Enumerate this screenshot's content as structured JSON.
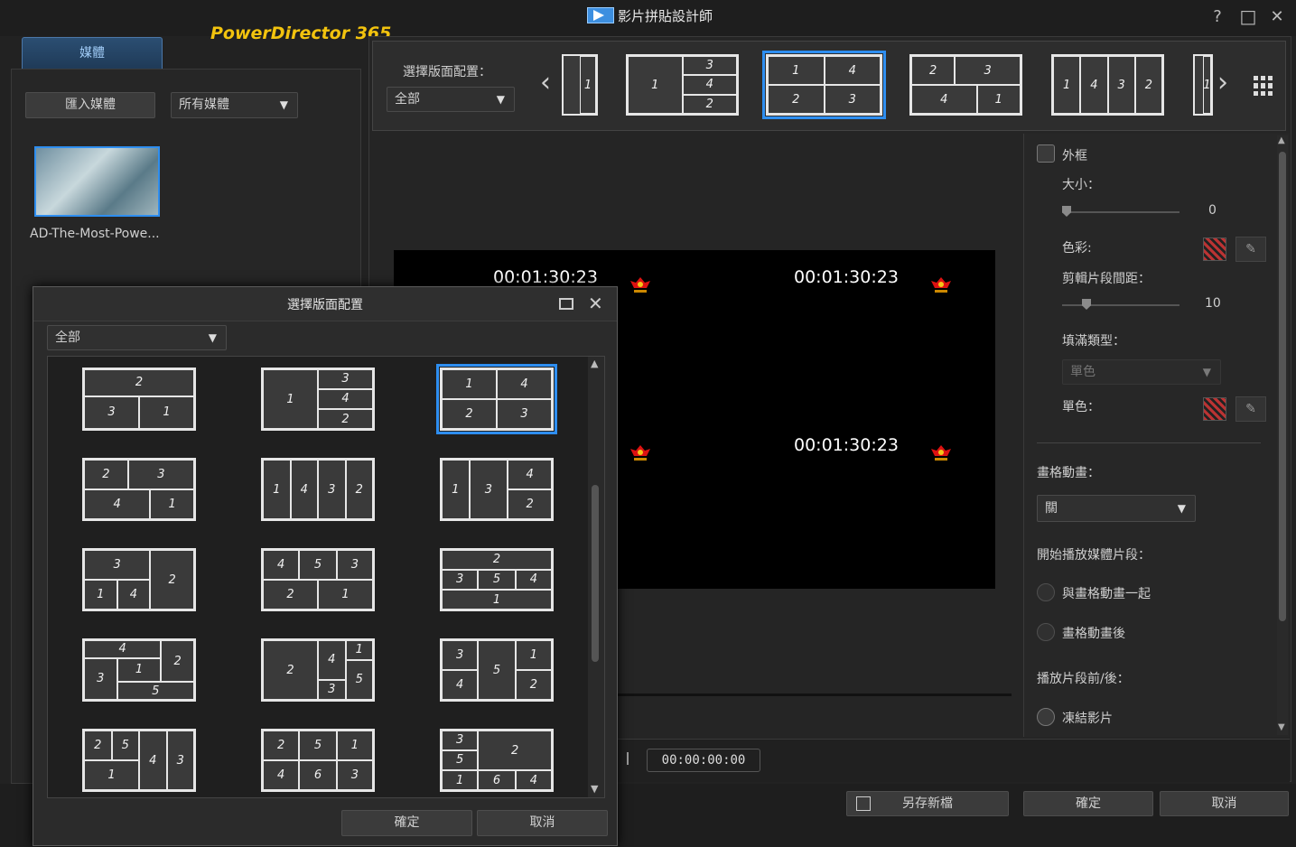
{
  "window": {
    "title": "影片拼貼設計師",
    "help": "?",
    "maximize": "□",
    "close": "✕"
  },
  "brand": "PowerDirector 365",
  "media": {
    "tab": "媒體",
    "import_button": "匯入媒體",
    "filter_value": "所有媒體",
    "clip_label": "AD-The-Most-Powe..."
  },
  "layout_strip": {
    "label": "選擇版面配置：",
    "filter_value": "全部",
    "layouts": [
      {
        "cells": [
          "1"
        ]
      },
      {
        "cells": [
          "1",
          "3",
          "4",
          "2"
        ]
      },
      {
        "cells": [
          "1",
          "4",
          "2",
          "3"
        ],
        "selected": true
      },
      {
        "cells": [
          "2",
          "3",
          "4",
          "1"
        ]
      },
      {
        "cells": [
          "1",
          "4",
          "3",
          "2"
        ]
      },
      {
        "cells": [
          "1"
        ]
      }
    ]
  },
  "preview": {
    "timecodes": [
      "00:01:30:23",
      "00:01:30:23",
      "00:01:30:23"
    ],
    "time_display": "00:00:00:00"
  },
  "props": {
    "border_label": "外框",
    "size_label": "大小：",
    "size_value": "0",
    "size_level": 0,
    "color_label": "色彩:",
    "gap_label": "剪輯片段間距：",
    "gap_value": "10",
    "gap_level": 0.1,
    "fill_label": "填滿類型：",
    "fill_value": "單色",
    "solid_label": "單色：",
    "anim_label": "畫格動畫：",
    "anim_value": "關",
    "start_label": "開始播放媒體片段：",
    "radio_with": "與畫格動畫一起",
    "radio_after": "畫格動畫後",
    "before_after_label": "播放片段前/後：",
    "radio_freeze": "凍結影片"
  },
  "footer": {
    "save_as": "另存新檔",
    "ok": "確定",
    "cancel": "取消"
  },
  "dialog": {
    "title": "選擇版面配置",
    "filter_value": "全部",
    "ok": "確定",
    "cancel": "取消",
    "layouts": [
      {
        "cells": [
          "2",
          "3",
          "1"
        ]
      },
      {
        "cells": [
          "1",
          "3",
          "4",
          "2"
        ]
      },
      {
        "cells": [
          "1",
          "4",
          "2",
          "3"
        ],
        "selected": true
      },
      {
        "cells": [
          "2",
          "3",
          "4",
          "1"
        ]
      },
      {
        "cells": [
          "1",
          "4",
          "3",
          "2"
        ]
      },
      {
        "cells": [
          "1",
          "3",
          "4",
          "2"
        ]
      },
      {
        "cells": [
          "3",
          "1",
          "4",
          "2"
        ]
      },
      {
        "cells": [
          "4",
          "5",
          "3",
          "2",
          "1"
        ]
      },
      {
        "cells": [
          "2",
          "3",
          "5",
          "4",
          "1"
        ]
      },
      {
        "cells": [
          "4",
          "2",
          "3",
          "1",
          "5"
        ]
      },
      {
        "cells": [
          "2",
          "4",
          "1",
          "3",
          "5"
        ]
      },
      {
        "cells": [
          "3",
          "1",
          "5",
          "4",
          "2"
        ]
      },
      {
        "cells": [
          "2",
          "5",
          "4",
          "3",
          "1"
        ]
      },
      {
        "cells": [
          "2",
          "5",
          "1",
          "4",
          "6",
          "3"
        ]
      },
      {
        "cells": [
          "3",
          "2",
          "5",
          "1",
          "6",
          "4"
        ]
      }
    ]
  }
}
